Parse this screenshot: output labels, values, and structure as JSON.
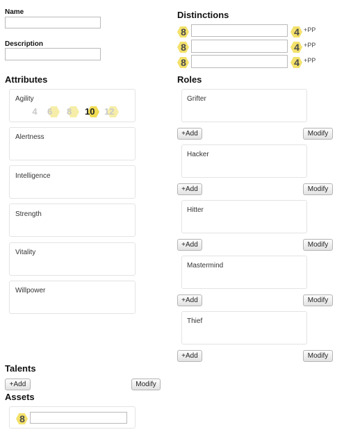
{
  "name": {
    "label": "Name",
    "value": ""
  },
  "description": {
    "label": "Description",
    "value": ""
  },
  "attributes": {
    "heading": "Attributes",
    "items": [
      {
        "name": "Agility",
        "dice": [
          "4",
          "6",
          "8",
          "10",
          "12"
        ],
        "selected": "10"
      },
      {
        "name": "Alertness"
      },
      {
        "name": "Intelligence"
      },
      {
        "name": "Strength"
      },
      {
        "name": "Vitality"
      },
      {
        "name": "Willpower"
      }
    ]
  },
  "distinctions": {
    "heading": "Distinctions",
    "rows": [
      {
        "die": "8",
        "value": "",
        "pp_die": "4",
        "pp_label": "+PP"
      },
      {
        "die": "8",
        "value": "",
        "pp_die": "4",
        "pp_label": "+PP"
      },
      {
        "die": "8",
        "value": "",
        "pp_die": "4",
        "pp_label": "+PP"
      }
    ]
  },
  "roles": {
    "heading": "Roles",
    "add_label": "+Add",
    "modify_label": "Modify",
    "items": [
      {
        "name": "Grifter"
      },
      {
        "name": "Hacker"
      },
      {
        "name": "Hitter"
      },
      {
        "name": "Mastermind"
      },
      {
        "name": "Thief"
      }
    ]
  },
  "talents": {
    "heading": "Talents",
    "add_label": "+Add",
    "modify_label": "Modify"
  },
  "assets": {
    "heading": "Assets",
    "die": "8",
    "value": ""
  },
  "colors": {
    "die_fill": "#f3e16b",
    "die_fill_light": "#f6eea8",
    "panel_border": "#e3e3e3"
  }
}
